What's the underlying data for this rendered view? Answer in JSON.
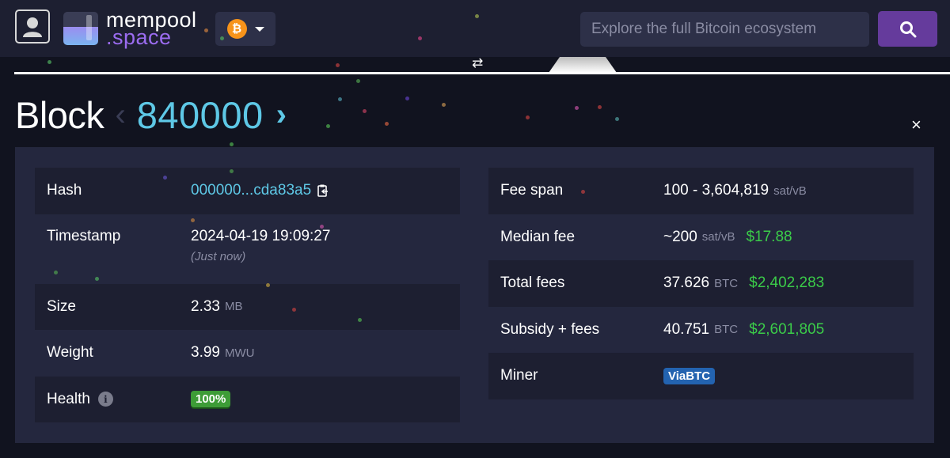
{
  "header": {
    "logo": {
      "line1": "mempool",
      "line2": ".space"
    },
    "network": {
      "icon": "bitcoin-icon",
      "symbol": "₿"
    },
    "search": {
      "placeholder": "Explore the full Bitcoin ecosystem",
      "value": ""
    }
  },
  "page": {
    "title": "Block",
    "block_height": "840000",
    "prev_chevron": "‹",
    "next_chevron": "›",
    "close": "×",
    "swap_icon": "⇄"
  },
  "left_table": {
    "hash": {
      "label": "Hash",
      "value": "000000...cda83a5"
    },
    "timestamp": {
      "label": "Timestamp",
      "value": "2024-04-19 19:09:27",
      "relative": "(Just now)"
    },
    "size": {
      "label": "Size",
      "value": "2.33",
      "unit": "MB"
    },
    "weight": {
      "label": "Weight",
      "value": "3.99",
      "unit": "MWU"
    },
    "health": {
      "label": "Health",
      "info_icon": "i",
      "value": "100%"
    }
  },
  "right_table": {
    "fee_span": {
      "label": "Fee span",
      "value": "100 - 3,604,819",
      "unit": "sat/vB"
    },
    "median_fee": {
      "label": "Median fee",
      "value": "~200",
      "unit": "sat/vB",
      "fiat": "$17.88"
    },
    "total_fees": {
      "label": "Total fees",
      "value": "37.626",
      "unit": "BTC",
      "fiat": "$2,402,283"
    },
    "subsidy_fees": {
      "label": "Subsidy + fees",
      "value": "40.751",
      "unit": "BTC",
      "fiat": "$2,601,805"
    },
    "miner": {
      "label": "Miner",
      "value": "ViaBTC"
    }
  },
  "colors": {
    "accent_blue": "#5ec8e6",
    "fiat_green": "#3bcc49",
    "health_green": "#3d9c37",
    "miner_blue": "#2363b0",
    "search_purple": "#653b9c"
  }
}
